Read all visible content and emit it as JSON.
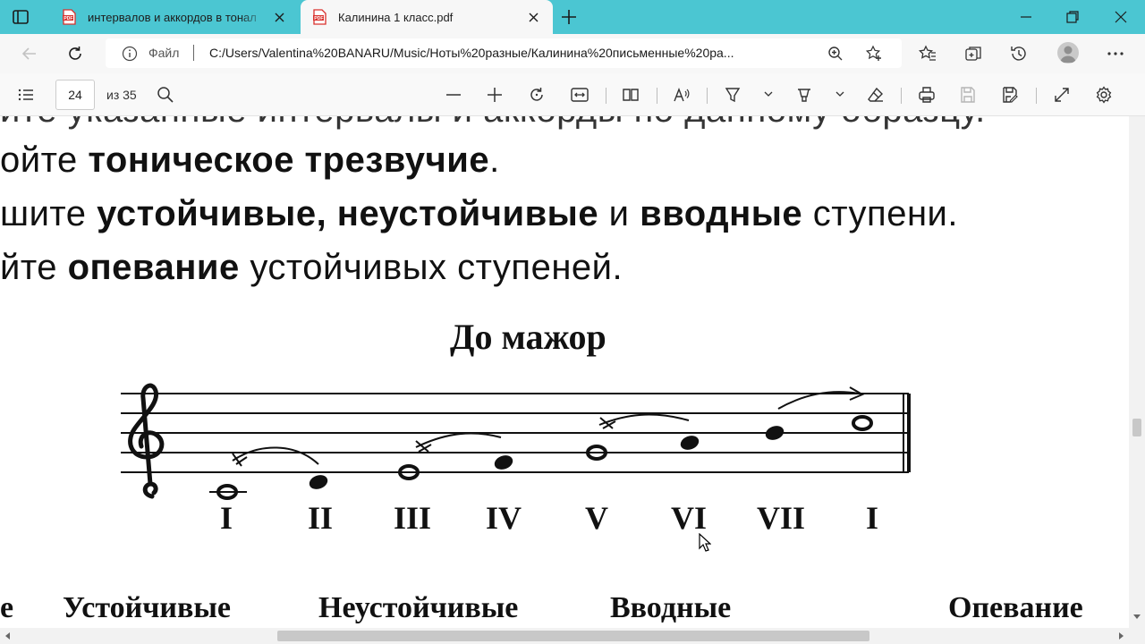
{
  "browser": {
    "tabs": [
      {
        "title": "интервалов и аккордов в тонал",
        "active": false
      },
      {
        "title": "Калинина 1 класс.pdf",
        "active": true
      }
    ],
    "address": {
      "scheme_label": "Файл",
      "url": "C:/Users/Valentina%20BANARU/Music/Ноты%20разные/Калинина%20письменные%20ра..."
    }
  },
  "pdf_toolbar": {
    "page_number": "24",
    "page_count_label": "из 35"
  },
  "document": {
    "instructions": [
      {
        "id": "line0",
        "normal_lead": "йте указанные интервалы и аккорды по данному образцу.",
        "bold": "",
        "normal_tail": ""
      },
      {
        "id": "line1",
        "normal_lead": "ойте ",
        "bold": "тоническое трезвучие",
        "normal_tail": "."
      },
      {
        "id": "line2",
        "normal_lead": "шите ",
        "bold": "устойчивые, неустойчивые",
        "normal_tail": " и ",
        "bold2": "вводные",
        "normal_tail2": " ступени."
      },
      {
        "id": "line3",
        "normal_lead": "йте ",
        "bold": "опевание",
        "normal_tail": " устойчивых ступеней."
      }
    ],
    "key_title": "До мажор",
    "degrees": [
      "I",
      "II",
      "III",
      "IV",
      "V",
      "VI",
      "VII",
      "I"
    ],
    "categories": [
      "е",
      "Устойчивые",
      "Неустойчивые",
      "Вводные",
      "Опевание"
    ]
  },
  "colors": {
    "titlebar": "#4bc6d2",
    "active_tab": "#f7f7f7",
    "pdf_icon": "#d9302c"
  },
  "icons": {
    "tab_actions": "tab-actions-icon",
    "pdf": "pdf-file-icon",
    "back": "back-arrow-icon",
    "refresh": "refresh-icon",
    "info": "info-icon",
    "zoom": "zoom-icon",
    "favorite_add": "add-favorite-icon",
    "favorites": "favorites-icon",
    "collections": "collections-icon",
    "history": "history-icon",
    "profile": "profile-avatar",
    "more": "more-icon"
  }
}
